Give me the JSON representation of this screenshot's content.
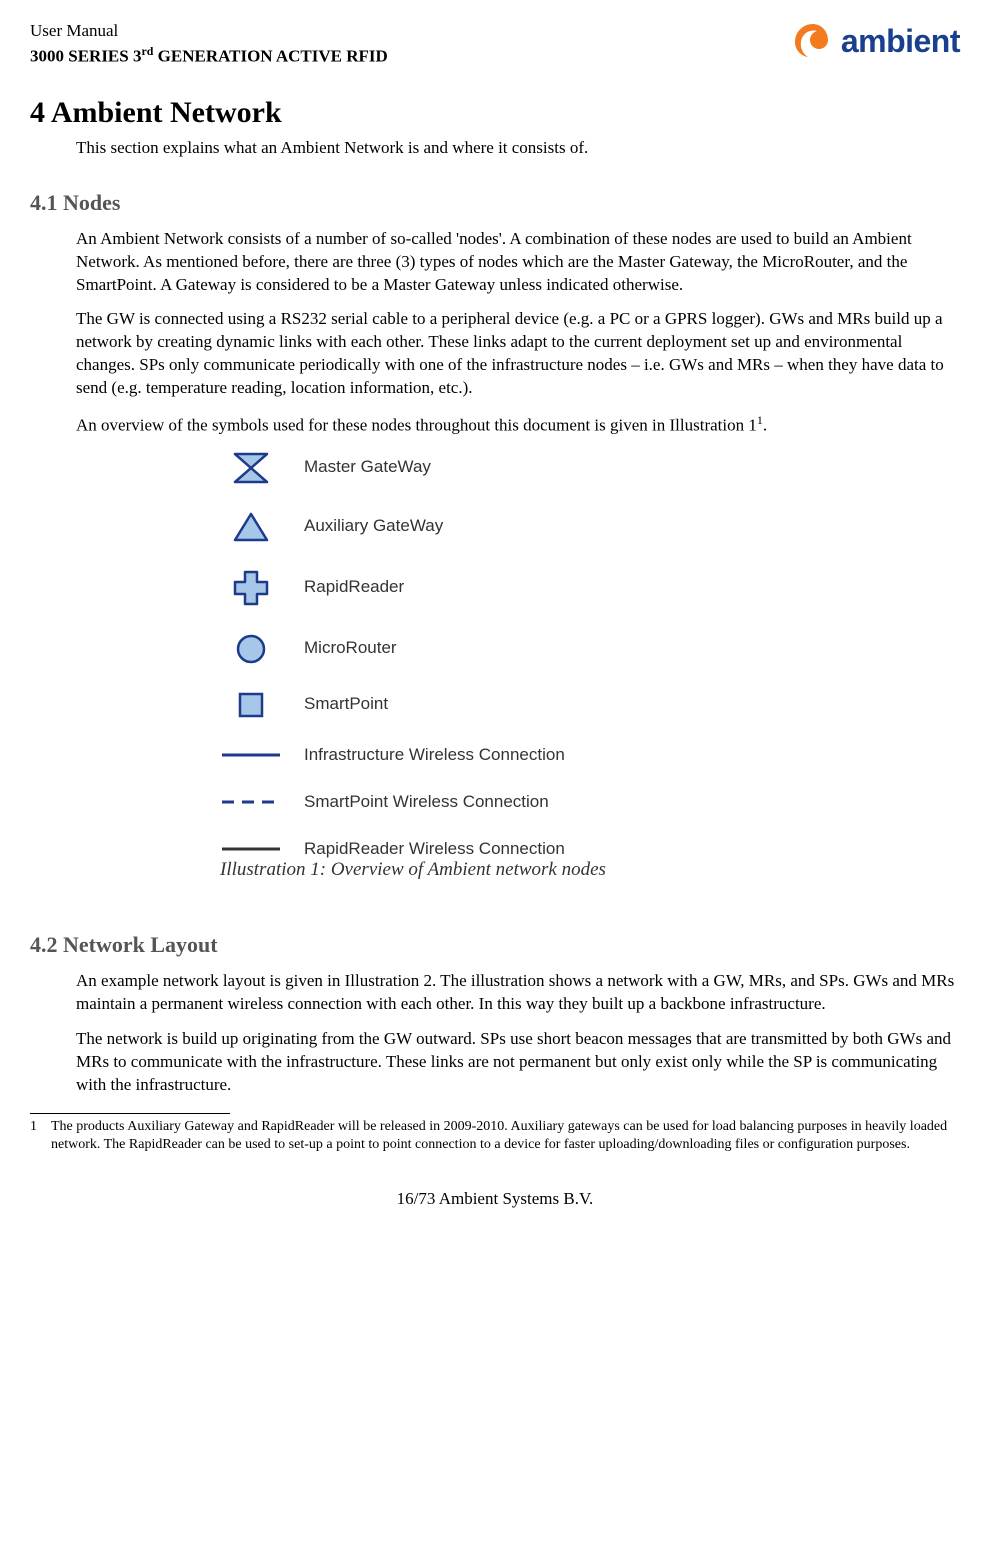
{
  "header": {
    "line1": "User Manual",
    "line2_prefix": "3000 SERIES 3",
    "line2_suffix": " GENERATION ACTIVE RFID",
    "ordinal": "rd",
    "logo_text": "ambient"
  },
  "section4": {
    "heading": "4   Ambient Network",
    "intro": "This section explains what an Ambient Network is and where it consists of."
  },
  "section41": {
    "heading": "4.1   Nodes",
    "p1": "An Ambient Network consists of a number of so-called 'nodes'. A combination of these nodes are used to build an Ambient Network. As mentioned before, there are three (3) types of nodes which are the Master Gateway, the MicroRouter, and the SmartPoint. A Gateway is considered to be a Master Gateway unless indicated otherwise.",
    "p2": "The GW is connected using a RS232 serial cable to a peripheral device (e.g. a PC or a GPRS logger). GWs and MRs build up a network by creating dynamic links with each other. These links adapt to the current deployment set up and environmental changes. SPs only communicate periodically with one of the infrastructure nodes – i.e. GWs and MRs – when they have data to send (e.g. temperature reading, location information, etc.).",
    "p3_prefix": "An overview of the symbols used for these nodes throughout this document is given in Illustration 1",
    "p3_suffix": ".",
    "footref": "1"
  },
  "legend": {
    "items": [
      {
        "label": "Master GateWay"
      },
      {
        "label": "Auxiliary GateWay"
      },
      {
        "label": "RapidReader"
      },
      {
        "label": "MicroRouter"
      },
      {
        "label": "SmartPoint"
      },
      {
        "label": "Infrastructure Wireless Connection"
      },
      {
        "label": "SmartPoint Wireless Connection"
      },
      {
        "label": "RapidReader Wireless Connection"
      }
    ],
    "caption": "Illustration 1: Overview of Ambient network nodes"
  },
  "section42": {
    "heading": "4.2   Network Layout",
    "p1": "An example network layout is given in Illustration 2. The illustration shows a network with a GW, MRs, and SPs. GWs and MRs maintain a permanent wireless connection with each other. In this way they built up a backbone infrastructure.",
    "p2": "The network is build up originating from the GW outward. SPs use short beacon messages that are transmitted by both GWs and MRs to communicate with the infrastructure. These links are not permanent but only exist only while the SP is communicating with the infrastructure."
  },
  "footnote": {
    "num": "1",
    "text": "The products Auxiliary Gateway and RapidReader will be released in 2009-2010. Auxiliary gateways can be used for load balancing purposes in heavily loaded network. The RapidReader can be used to set-up a point to point connection to a device for faster uploading/downloading files or configuration purposes."
  },
  "footer": {
    "text": "16/73     Ambient Systems B.V."
  },
  "colors": {
    "blue_fill": "#a7c7e8",
    "blue_stroke": "#1e3a8a",
    "conn_blue": "#1e3a8a",
    "conn_black": "#333333"
  }
}
